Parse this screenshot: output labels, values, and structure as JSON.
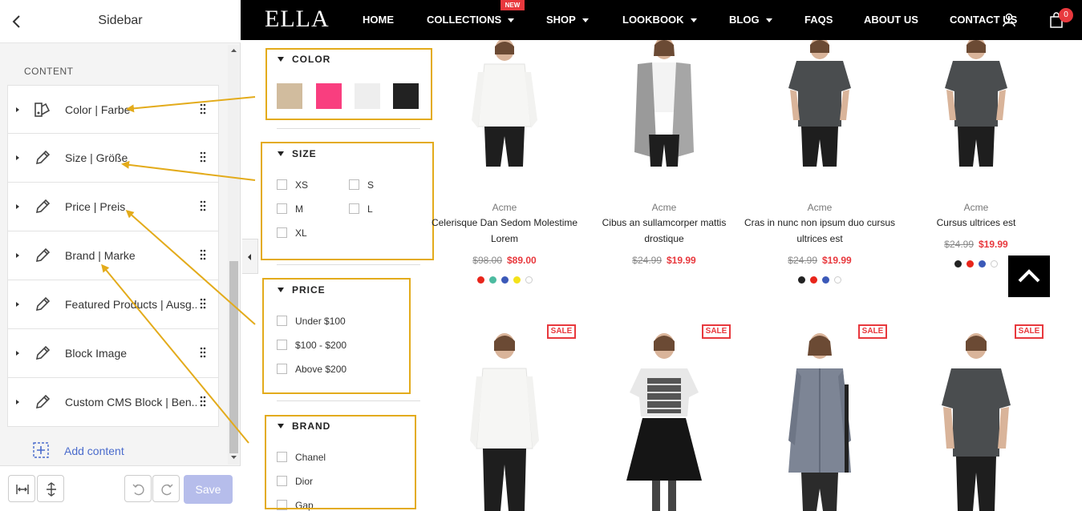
{
  "sidebar": {
    "title": "Sidebar",
    "section_label": "CONTENT",
    "items": [
      {
        "label": "Color | Farbe",
        "icon": "palette-icon"
      },
      {
        "label": "Size | Größe",
        "icon": "pencil-icon"
      },
      {
        "label": "Price | Preis",
        "icon": "pencil-icon"
      },
      {
        "label": "Brand | Marke",
        "icon": "pencil-icon"
      },
      {
        "label": "Featured Products | Ausg...",
        "icon": "pencil-icon"
      },
      {
        "label": "Block Image",
        "icon": "pencil-icon"
      },
      {
        "label": "Custom CMS Block | Ben...",
        "icon": "pencil-icon"
      }
    ],
    "add_content_label": "Add content",
    "save_label": "Save"
  },
  "store": {
    "logo": "ELLA",
    "nav": [
      {
        "label": "HOME",
        "dropdown": false
      },
      {
        "label": "COLLECTIONS",
        "dropdown": true
      },
      {
        "label": "SHOP",
        "dropdown": true
      },
      {
        "label": "LOOKBOOK",
        "dropdown": true
      },
      {
        "label": "BLOG",
        "dropdown": true
      },
      {
        "label": "FAQS",
        "dropdown": false
      },
      {
        "label": "ABOUT US",
        "dropdown": false
      },
      {
        "label": "CONTACT US",
        "dropdown": false
      }
    ],
    "new_badge": "NEW",
    "cart_count": "0"
  },
  "filters": {
    "color": {
      "title": "COLOR",
      "swatches": [
        "#d1bc9e",
        "#f93e7f",
        "#eeeeee",
        "#222222"
      ]
    },
    "size": {
      "title": "SIZE",
      "options": [
        "XS",
        "S",
        "M",
        "L",
        "XL"
      ]
    },
    "price": {
      "title": "PRICE",
      "options": [
        "Under $100",
        "$100 - $200",
        "Above $200"
      ]
    },
    "brand": {
      "title": "BRAND",
      "options": [
        "Chanel",
        "Dior",
        "Gap"
      ]
    }
  },
  "products": [
    {
      "vendor": "Acme",
      "title": "Celerisque Dan Sedom Molestime Lorem",
      "old_price": "$98.00",
      "price": "$89.00",
      "colors": [
        "#e8251b",
        "#4cbba0",
        "#3b59b8",
        "#f4e21a",
        "#ffffff"
      ],
      "image": "white-top-black-pants"
    },
    {
      "vendor": "Acme",
      "title": "Cibus an sullamcorper mattis drostique",
      "old_price": "$24.99",
      "price": "$19.99",
      "colors": [],
      "image": "grey-cardigan"
    },
    {
      "vendor": "Acme",
      "title": "Cras in nunc non ipsum duo cursus ultrices est",
      "old_price": "$24.99",
      "price": "$19.99",
      "colors": [
        "#222222",
        "#e8251b",
        "#3b59b8",
        "#ffffff"
      ],
      "image": "dark-tee"
    },
    {
      "vendor": "Acme",
      "title": "Cursus ultrices est",
      "old_price": "$24.99",
      "price": "$19.99",
      "colors": [
        "#222222",
        "#e8251b",
        "#3b59b8",
        "#ffffff"
      ],
      "image": "dark-tee"
    },
    {
      "sale": "SALE",
      "image": "white-top-black-pants"
    },
    {
      "sale": "SALE",
      "image": "print-top-black-skirt"
    },
    {
      "sale": "SALE",
      "image": "chambray-shirt"
    },
    {
      "sale": "SALE",
      "image": "dark-tee"
    }
  ],
  "colors": {
    "accent": "#e8383d",
    "annotation": "#e3ab1b",
    "link": "#4a6bcc",
    "save_disabled": "#b6bdeb"
  }
}
